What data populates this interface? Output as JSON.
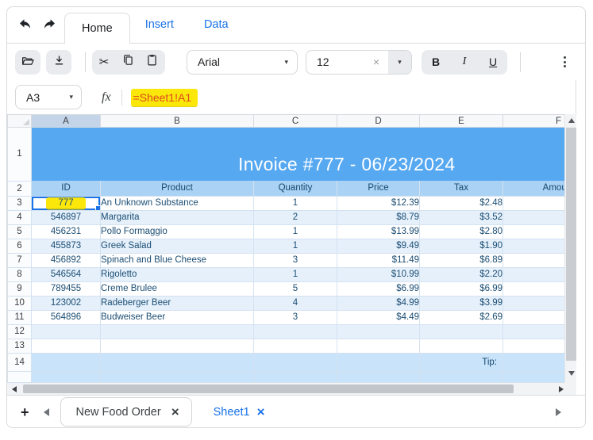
{
  "ribbon_tabs": [
    {
      "label": "Home",
      "active": true
    },
    {
      "label": "Insert",
      "active": false
    },
    {
      "label": "Data",
      "active": false
    }
  ],
  "toolbar": {
    "font_family": "Arial",
    "font_size": "12",
    "bold_label": "B",
    "italic_label": "I",
    "underline_label": "U"
  },
  "icons": {
    "caret": "▾",
    "clear": "×",
    "close": "×",
    "scissors": "✂",
    "add": "+"
  },
  "formula_bar": {
    "cell_ref": "A3",
    "fx_label": "fx",
    "formula": "=Sheet1!A1"
  },
  "grid": {
    "column_letters": [
      "A",
      "B",
      "C",
      "D",
      "E",
      "F"
    ],
    "selected_column": "A",
    "selected_cell": "A3",
    "title_row_number": "1",
    "title": "Invoice #777 - 06/23/2024",
    "header_row_number": "2",
    "column_headers": [
      "ID",
      "Product",
      "Quantity",
      "Price",
      "Tax",
      "Amount"
    ],
    "data_rows": [
      {
        "n": "3",
        "id": "777",
        "product": "An Unknown Substance",
        "quantity": "1",
        "price": "$12.39",
        "tax": "$2.48",
        "amount": "",
        "selected": true,
        "id_highlighted": true
      },
      {
        "n": "4",
        "id": "546897",
        "product": "Margarita",
        "quantity": "2",
        "price": "$8.79",
        "tax": "$3.52",
        "amount": ""
      },
      {
        "n": "5",
        "id": "456231",
        "product": "Pollo Formaggio",
        "quantity": "1",
        "price": "$13.99",
        "tax": "$2.80",
        "amount": ""
      },
      {
        "n": "6",
        "id": "455873",
        "product": "Greek Salad",
        "quantity": "1",
        "price": "$9.49",
        "tax": "$1.90",
        "amount": ""
      },
      {
        "n": "7",
        "id": "456892",
        "product": "Spinach and Blue Cheese",
        "quantity": "3",
        "price": "$11.49",
        "tax": "$6.89",
        "amount": ""
      },
      {
        "n": "8",
        "id": "546564",
        "product": "Rigoletto",
        "quantity": "1",
        "price": "$10.99",
        "tax": "$2.20",
        "amount": ""
      },
      {
        "n": "9",
        "id": "789455",
        "product": "Creme Brulee",
        "quantity": "5",
        "price": "$6.99",
        "tax": "$6.99",
        "amount": ""
      },
      {
        "n": "10",
        "id": "123002",
        "product": "Radeberger Beer",
        "quantity": "4",
        "price": "$4.99",
        "tax": "$3.99",
        "amount": ""
      },
      {
        "n": "11",
        "id": "564896",
        "product": "Budweiser Beer",
        "quantity": "3",
        "price": "$4.49",
        "tax": "$2.69",
        "amount": ""
      }
    ],
    "empty_row_numbers": [
      "12",
      "13"
    ],
    "tip_row": {
      "n": "14",
      "label": "Tip:"
    }
  },
  "sheet_bar": {
    "add_label": "+",
    "tabs": [
      {
        "label": "New Food Order",
        "active": true
      },
      {
        "label": "Sheet1",
        "active": false
      }
    ]
  },
  "colors": {
    "title_bg": "#56a8f1",
    "table_header_bg": "#a9d2f4",
    "alt_row_bg": "#e5f0fb",
    "tip_row_bg": "#c8e3fa",
    "cell_text": "#1c4e74",
    "accent_blue": "#1a73e8",
    "formula_text": "#df4a20",
    "highlight_yellow": "#fbe70a"
  }
}
